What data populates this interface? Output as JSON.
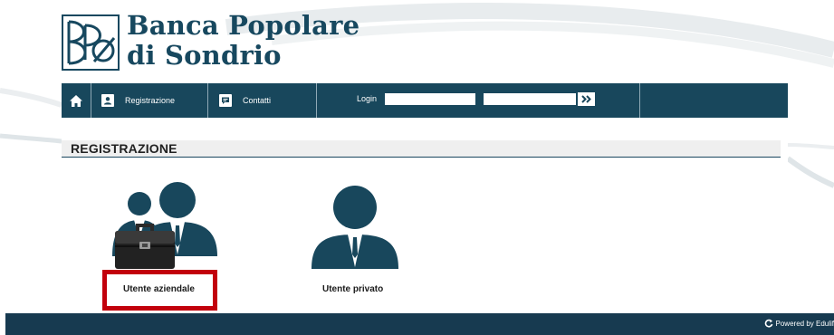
{
  "brand": {
    "line1": "Banca Popolare",
    "line2": "di Sondrio"
  },
  "nav": {
    "registrazione": "Registrazione",
    "contatti": "Contatti",
    "login_label": "Login",
    "username_value": "",
    "password_value": ""
  },
  "section": {
    "title": "REGISTRAZIONE"
  },
  "options": {
    "aziendale": "Utente aziendale",
    "privato": "Utente privato"
  },
  "footer": {
    "powered": "Powered by Edulif"
  },
  "colors": {
    "nav_bg": "#18475c",
    "footer_bg": "#173a50",
    "brand": "#17485f",
    "highlight": "#c2000c"
  },
  "icons": [
    "home-icon",
    "person-card-icon",
    "chat-bubble-icon",
    "double-chevron-right-icon",
    "business-users-icon",
    "briefcase-icon",
    "private-user-icon",
    "refresh-icon"
  ]
}
